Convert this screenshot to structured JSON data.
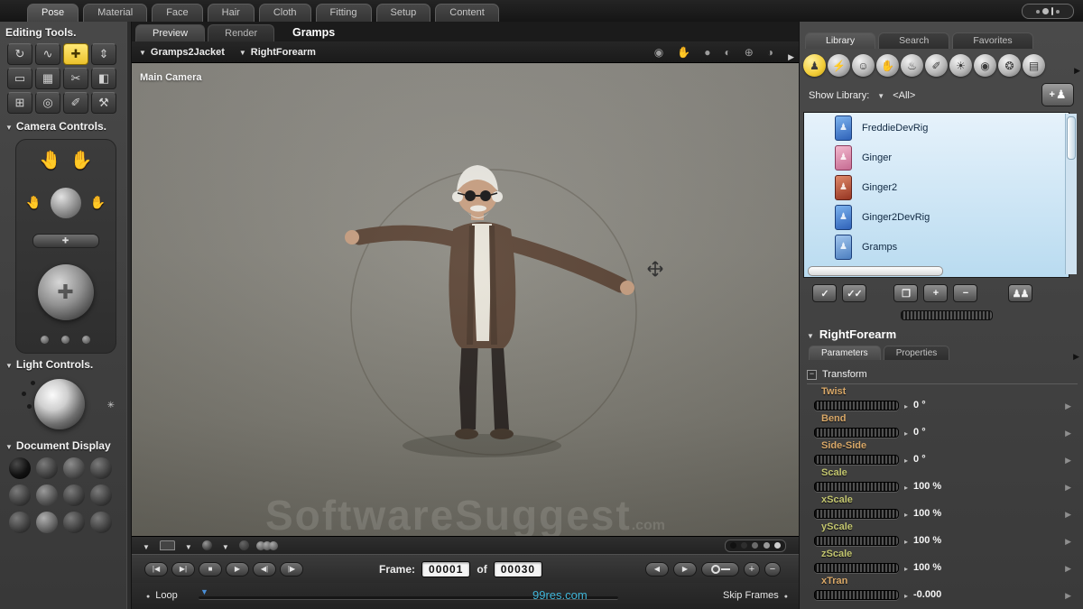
{
  "top_tabs": [
    {
      "name": "pose",
      "label": "Pose",
      "active": true
    },
    {
      "name": "material",
      "label": "Material"
    },
    {
      "name": "face",
      "label": "Face"
    },
    {
      "name": "hair",
      "label": "Hair"
    },
    {
      "name": "cloth",
      "label": "Cloth"
    },
    {
      "name": "fitting",
      "label": "Fitting"
    },
    {
      "name": "setup",
      "label": "Setup"
    },
    {
      "name": "content",
      "label": "Content"
    }
  ],
  "left": {
    "editing_tools_title": "Editing Tools.",
    "tools": [
      {
        "name": "rotate",
        "glyph": "↻"
      },
      {
        "name": "twist",
        "glyph": "∿"
      },
      {
        "name": "translate-pull",
        "glyph": "✚",
        "selected": true
      },
      {
        "name": "translate-in-out",
        "glyph": "⇕"
      },
      {
        "name": "scale",
        "glyph": "▭"
      },
      {
        "name": "taper",
        "glyph": "▦"
      },
      {
        "name": "chain-break",
        "glyph": "✂"
      },
      {
        "name": "color",
        "glyph": "◧"
      },
      {
        "name": "grouping",
        "glyph": "⊞"
      },
      {
        "name": "view-magnifier",
        "glyph": "◎"
      },
      {
        "name": "morphing-tool",
        "glyph": "✐"
      },
      {
        "name": "direct-manipulation",
        "glyph": "⚒"
      }
    ],
    "camera_controls_title": "Camera Controls.",
    "light_controls_title": "Light Controls.",
    "document_display_title": "Document Display"
  },
  "center": {
    "view_tabs": [
      {
        "name": "preview",
        "label": "Preview",
        "active": true
      },
      {
        "name": "render",
        "label": "Render"
      }
    ],
    "document_tab": "Gramps",
    "breadcrumb": {
      "figure": "Gramps2Jacket",
      "actor": "RightForearm"
    },
    "header_icons": [
      {
        "name": "face-camera-icon",
        "glyph": "◉"
      },
      {
        "name": "hand-camera-icon",
        "glyph": "✋"
      },
      {
        "name": "dolly-ball-icon",
        "glyph": "●"
      },
      {
        "name": "rotate-ball-icon",
        "glyph": "◐"
      },
      {
        "name": "crosshair-ball-icon",
        "glyph": "⊕"
      },
      {
        "name": "flash-ball-icon",
        "glyph": "◑"
      }
    ],
    "camera_label": "Main Camera",
    "watermark": "SoftwareSuggest",
    "watermark_suffix": ".com",
    "watermark_bottom": "99res.com",
    "transport_buttons": [
      {
        "name": "first-frame",
        "glyph": "|◀"
      },
      {
        "name": "last-frame",
        "glyph": "▶|"
      },
      {
        "name": "stop",
        "glyph": "■"
      },
      {
        "name": "play",
        "glyph": "▶"
      },
      {
        "name": "prev-frame",
        "glyph": "◀|"
      },
      {
        "name": "next-frame",
        "glyph": "|▶"
      }
    ],
    "frame": {
      "label": "Frame:",
      "current": "00001",
      "of": "of",
      "total": "00030"
    },
    "right_transport": {
      "prev": "◀",
      "next": "▶",
      "plus": "+",
      "minus": "−"
    },
    "loop_label": "Loop",
    "skip_frames_label": "Skip Frames"
  },
  "right": {
    "panel_tabs": [
      {
        "name": "library",
        "label": "Library",
        "active": true
      },
      {
        "name": "search",
        "label": "Search"
      },
      {
        "name": "favorites",
        "label": "Favorites"
      }
    ],
    "categories": [
      {
        "name": "figures",
        "glyph": "♟",
        "active": true
      },
      {
        "name": "poses",
        "glyph": "⚡"
      },
      {
        "name": "expression",
        "glyph": "☺"
      },
      {
        "name": "hands",
        "glyph": "✋"
      },
      {
        "name": "hair",
        "glyph": "♨"
      },
      {
        "name": "props",
        "glyph": "✐"
      },
      {
        "name": "lights",
        "glyph": "☀"
      },
      {
        "name": "cameras",
        "glyph": "◉"
      },
      {
        "name": "materials",
        "glyph": "❂"
      },
      {
        "name": "scenes",
        "glyph": "▤"
      }
    ],
    "show_library": {
      "label": "Show Library:",
      "value": "<All>"
    },
    "library_items": [
      {
        "label": "FreddieDevRig"
      },
      {
        "label": "Ginger"
      },
      {
        "label": "Ginger2"
      },
      {
        "label": "Ginger2DevRig"
      },
      {
        "label": "Gramps"
      }
    ],
    "list_buttons": [
      {
        "name": "checkmark-single",
        "glyph": "✓"
      },
      {
        "name": "checkmark-double",
        "glyph": "✓✓"
      },
      {
        "name": "add-folder",
        "glyph": "❐"
      },
      {
        "name": "add-to-library",
        "glyph": "+"
      },
      {
        "name": "remove-from-library",
        "glyph": "−"
      },
      {
        "name": "swap-figure",
        "glyph": "♟♟"
      }
    ],
    "selected_actor": "RightForearm",
    "param_tabs": [
      {
        "name": "parameters",
        "label": "Parameters",
        "active": true
      },
      {
        "name": "properties",
        "label": "Properties"
      }
    ],
    "group_label": "Transform",
    "dials": [
      {
        "name": "twist",
        "label": "Twist",
        "value": "0 °",
        "color": "#d9a868"
      },
      {
        "name": "bend",
        "label": "Bend",
        "value": "0 °",
        "color": "#d9a868"
      },
      {
        "name": "side-side",
        "label": "Side-Side",
        "value": "0 °",
        "color": "#d9a868"
      },
      {
        "name": "scale",
        "label": "Scale",
        "value": "100 %",
        "color": "#c2c56e"
      },
      {
        "name": "xscale",
        "label": "xScale",
        "value": "100 %",
        "color": "#c2c56e"
      },
      {
        "name": "yscale",
        "label": "yScale",
        "value": "100 %",
        "color": "#c2c56e"
      },
      {
        "name": "zscale",
        "label": "zScale",
        "value": "100 %",
        "color": "#c2c56e"
      },
      {
        "name": "xtran",
        "label": "xTran",
        "value": "-0.000",
        "color": "#d9a868"
      }
    ]
  }
}
